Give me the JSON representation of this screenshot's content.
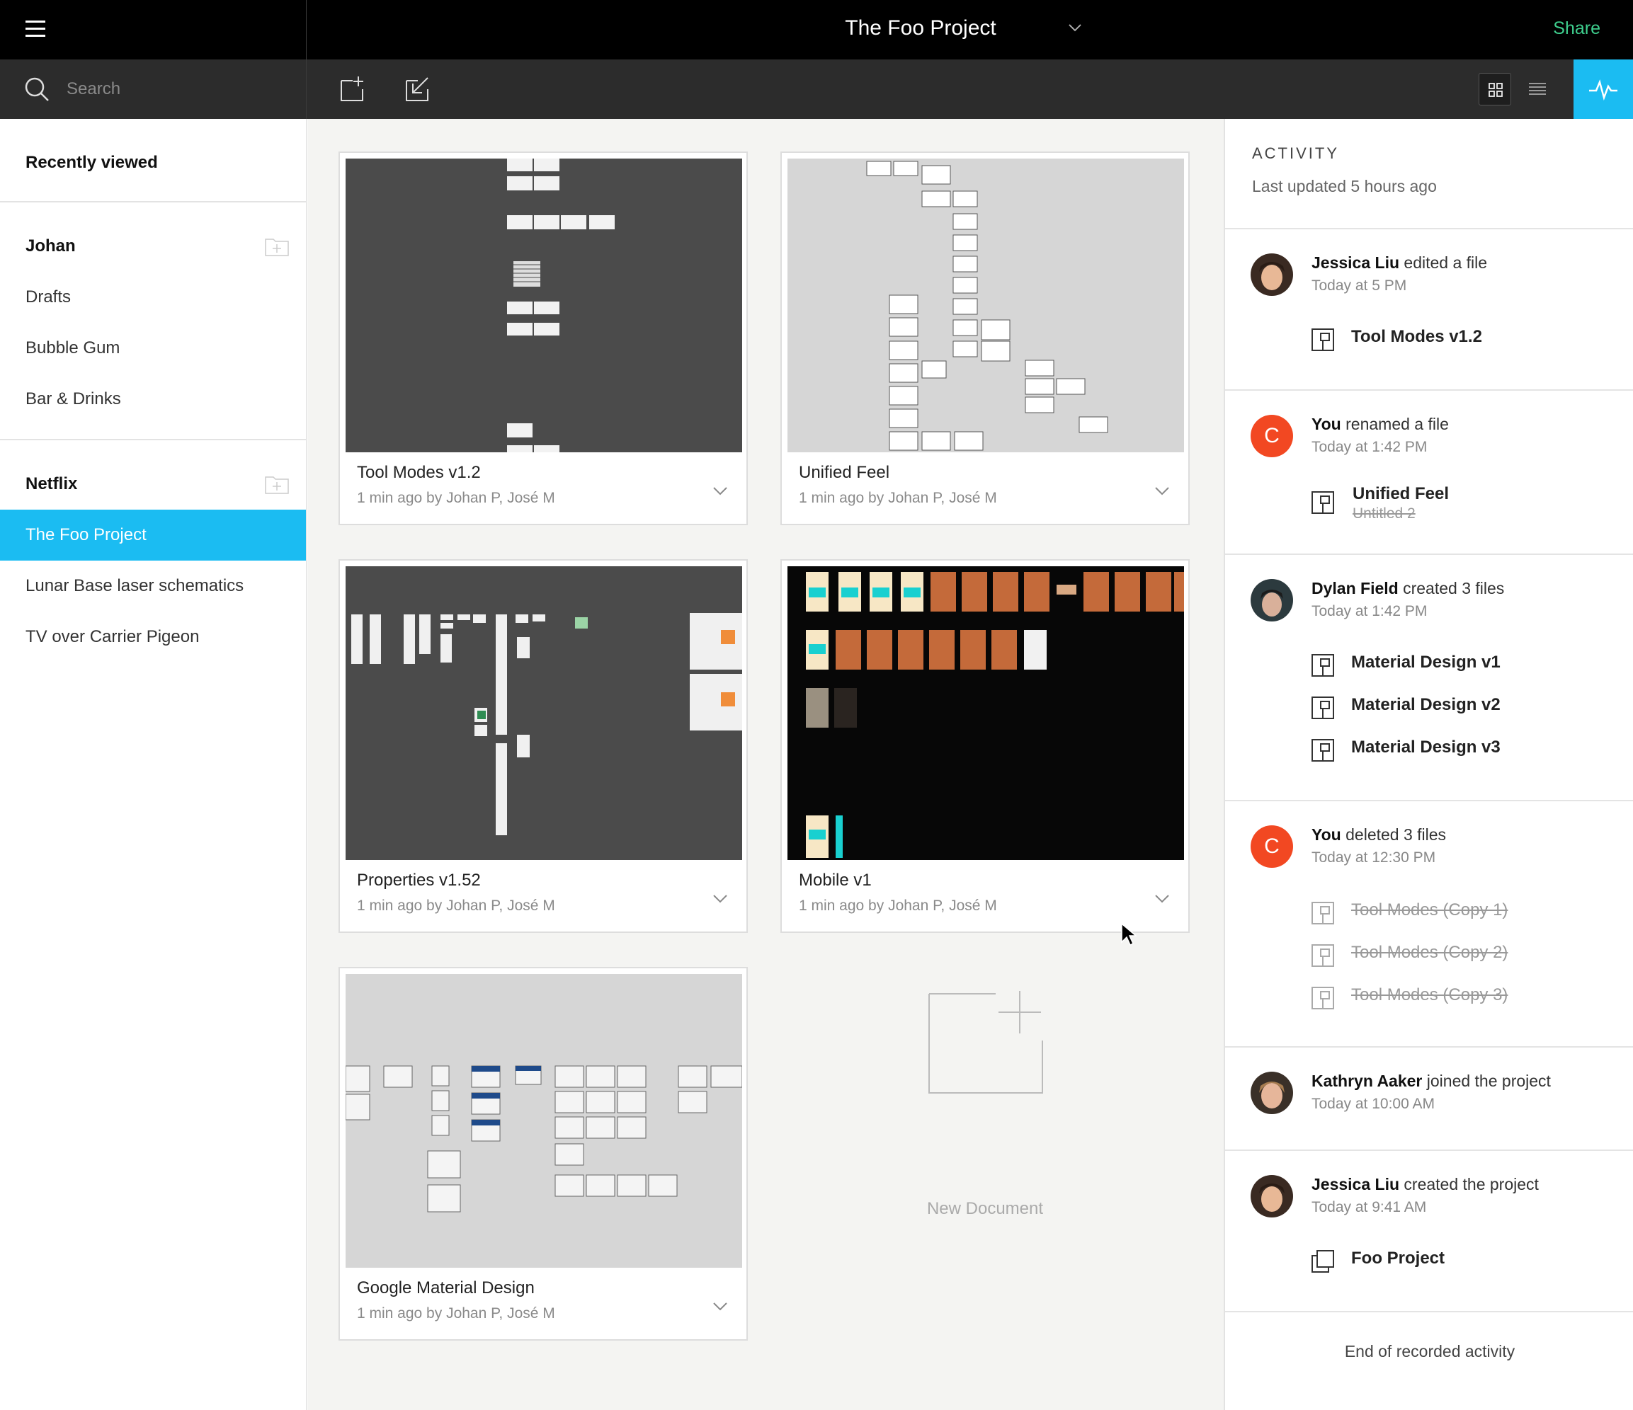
{
  "header": {
    "project_title": "The Foo Project",
    "share_label": "Share"
  },
  "search": {
    "placeholder": "Search"
  },
  "sidebar": {
    "recent_label": "Recently viewed",
    "teams": [
      {
        "name": "Johan",
        "projects": [
          "Drafts",
          "Bubble Gum",
          "Bar & Drinks"
        ]
      },
      {
        "name": "Netflix",
        "projects": [
          "The Foo Project",
          "Lunar Base laser schematics",
          "TV over Carrier Pigeon"
        ]
      }
    ],
    "active_project": "The Foo Project"
  },
  "files": [
    {
      "title": "Tool Modes v1.2",
      "meta": "1 min ago by Johan P, José M",
      "thumb_theme": "dark-gray"
    },
    {
      "title": "Unified Feel",
      "meta": "1 min ago by Johan P, José M",
      "thumb_theme": "light-gray"
    },
    {
      "title": "Properties v1.52",
      "meta": "1 min ago by Johan P, José M",
      "thumb_theme": "dark-gray"
    },
    {
      "title": "Mobile v1",
      "meta": "1 min ago by Johan P, José M",
      "thumb_theme": "black"
    },
    {
      "title": "Google Material Design",
      "meta": "1 min ago by Johan P, José M",
      "thumb_theme": "light-gray"
    }
  ],
  "new_document_label": "New Document",
  "activity": {
    "title": "ACTIVITY",
    "last_updated": "Last updated 5 hours ago",
    "entries": [
      {
        "actor": "Jessica Liu",
        "action": " edited a file",
        "time": "Today at 5 PM",
        "files": [
          {
            "name": "Tool Modes v1.2"
          }
        ]
      },
      {
        "actor": "You",
        "action": " renamed a file",
        "time": "Today at 1:42 PM",
        "files": [
          {
            "name": "Unified Feel",
            "old_name": "Untitled 2"
          }
        ]
      },
      {
        "actor": "Dylan Field",
        "action": " created 3 files",
        "time": "Today at 1:42 PM",
        "files": [
          {
            "name": "Material Design v1"
          },
          {
            "name": "Material Design v2"
          },
          {
            "name": "Material Design v3"
          }
        ]
      },
      {
        "actor": "You",
        "action": " deleted 3 files",
        "time": "Today at 12:30 PM",
        "files": [
          {
            "name": "Tool Modes (Copy 1)",
            "deleted": true
          },
          {
            "name": "Tool Modes (Copy 2)",
            "deleted": true
          },
          {
            "name": "Tool Modes (Copy 3)",
            "deleted": true
          }
        ]
      },
      {
        "actor": "Kathryn Aaker",
        "action": " joined the project",
        "time": "Today at 10:00 AM",
        "files": []
      },
      {
        "actor": "Jessica Liu",
        "action": " created the project",
        "time": "Today at 9:41 AM",
        "files": [
          {
            "name": "Foo Project"
          }
        ]
      }
    ],
    "avatar_letter": "C",
    "end_label": "End of recorded activity"
  },
  "colors": {
    "accent": "#1bbcf2",
    "share": "#3ecf8e",
    "avatar_you": "#f24822"
  },
  "icons": [
    "menu-icon",
    "search-icon",
    "new-file-icon",
    "import-icon",
    "grid-view-icon",
    "list-view-icon",
    "activity-pulse-icon",
    "folder-add-icon",
    "chevron-down-icon",
    "file-icon"
  ]
}
